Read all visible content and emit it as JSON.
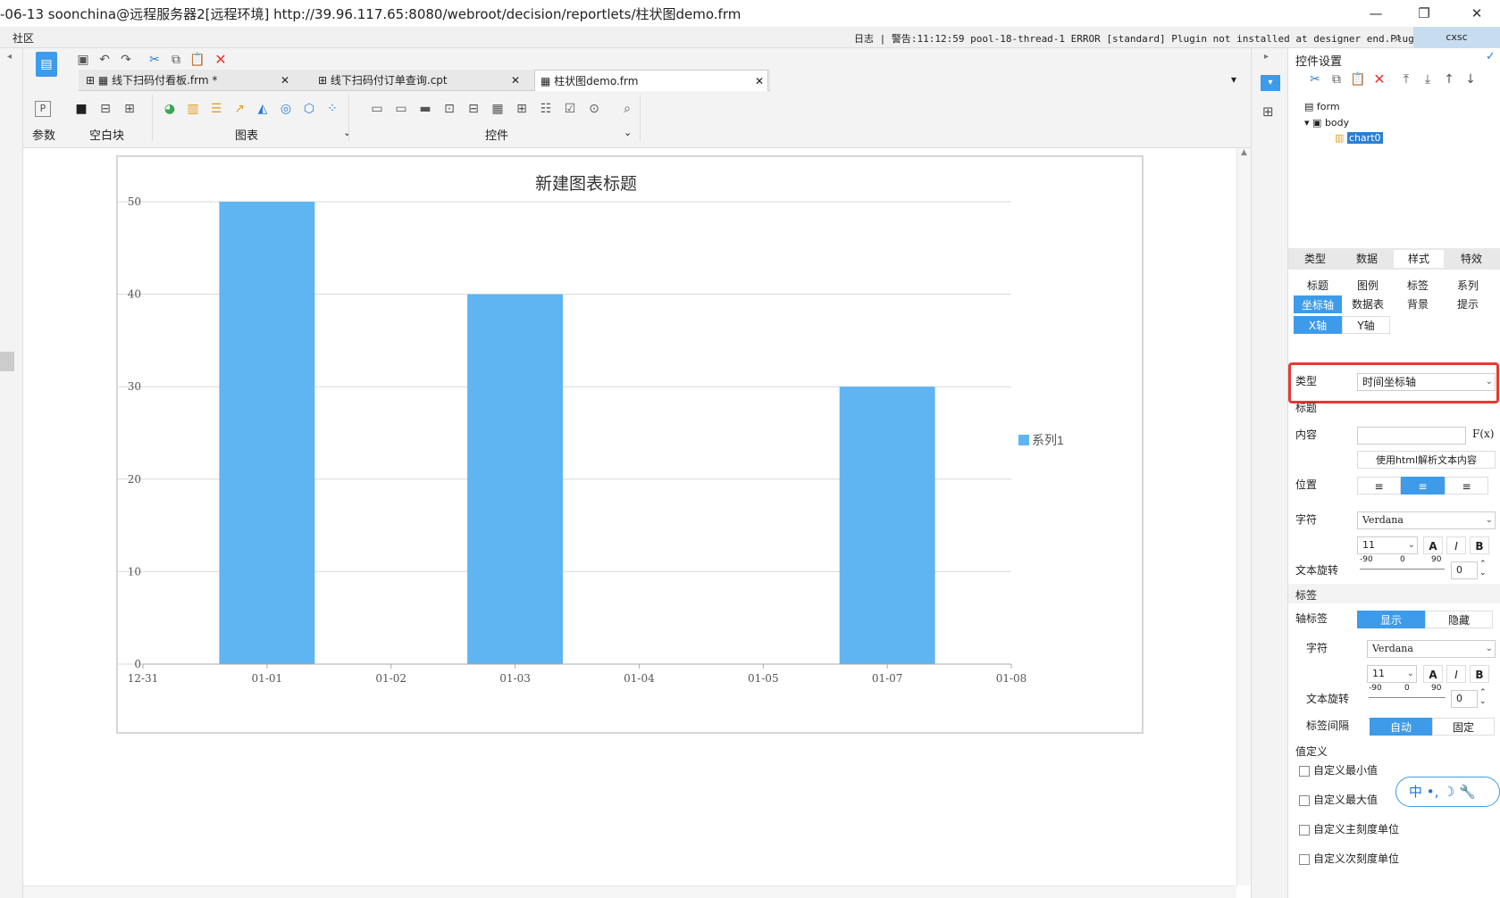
{
  "window": {
    "title": "-06-13 soonchina@远程服务器2[远程环境]     http://39.96.117.65:8080/webroot/decision/reportlets/柱状图demo.frm"
  },
  "menubar": {
    "community": "社区",
    "log": "日志 | 警告:11:12:59 pool-18-thread-1 ERROR [standard] Plugin not installed at designer end.Plugi...",
    "user": "cxsc"
  },
  "tabs": [
    {
      "label": "线下扫码付看板.frm *"
    },
    {
      "label": "线下扫码付订单查询.cpt"
    },
    {
      "label": "柱状图demo.frm"
    }
  ],
  "groups": {
    "params": "参数",
    "blank": "空白块",
    "chart": "图表",
    "widget": "控件"
  },
  "chart_data": {
    "type": "bar",
    "title": "新建图表标题",
    "x": [
      "12-31",
      "01-01",
      "01-02",
      "01-03",
      "01-04",
      "01-05",
      "01-07",
      "01-08"
    ],
    "series": [
      {
        "name": "系列1",
        "points": [
          {
            "x": "01-01",
            "y": 50
          },
          {
            "x": "01-03",
            "y": 40
          },
          {
            "x": "01-07",
            "y": 30
          }
        ]
      }
    ],
    "yticks": [
      "0",
      "10",
      "20",
      "30",
      "40",
      "50"
    ],
    "ylim": [
      0,
      50
    ],
    "grid": true,
    "legend": "right",
    "color": "#5fb4f2"
  },
  "panel": {
    "header": "控件设置",
    "tree": {
      "form": "form",
      "body": "body",
      "chart": "chart0"
    },
    "main_tabs": [
      "类型",
      "数据",
      "样式",
      "特效"
    ],
    "sub_tabs": [
      "标题",
      "图例",
      "标签",
      "系列",
      "坐标轴",
      "数据表",
      "背景",
      "提示"
    ],
    "axis_tabs": [
      "X轴",
      "Y轴"
    ],
    "type_label": "类型",
    "type_value": "时间坐标轴",
    "title_section": "标题",
    "content_label": "内容",
    "fx_label": "F(x)",
    "html_btn": "使用html解析文本内容",
    "position_label": "位置",
    "font_label": "字符",
    "font_value": "Verdana",
    "font_size": "11",
    "rotation_label": "文本旋转",
    "rot_min": "-90",
    "rot_mid": "0",
    "rot_max": "90",
    "rot_value": "0",
    "label_section": "标签",
    "axis_label": "轴标签",
    "show_btn": "显示",
    "hide_btn": "隐藏",
    "font_label2": "字符",
    "font_value2": "Verdana",
    "font_size2": "11",
    "rotation_label2": "文本旋转",
    "rot_value2": "0",
    "interval_label": "标签间隔",
    "auto_btn": "自动",
    "fixed_btn": "固定",
    "value_section": "值定义",
    "custom_min": "自定义最小值",
    "custom_max": "自定义最大值",
    "custom_major": "自定义主刻度单位",
    "custom_minor": "自定义次刻度单位"
  },
  "ime": {
    "text": "中 •, ☽ 🔧"
  },
  "accent": "#3d9be9",
  "highlight": "#e53935"
}
